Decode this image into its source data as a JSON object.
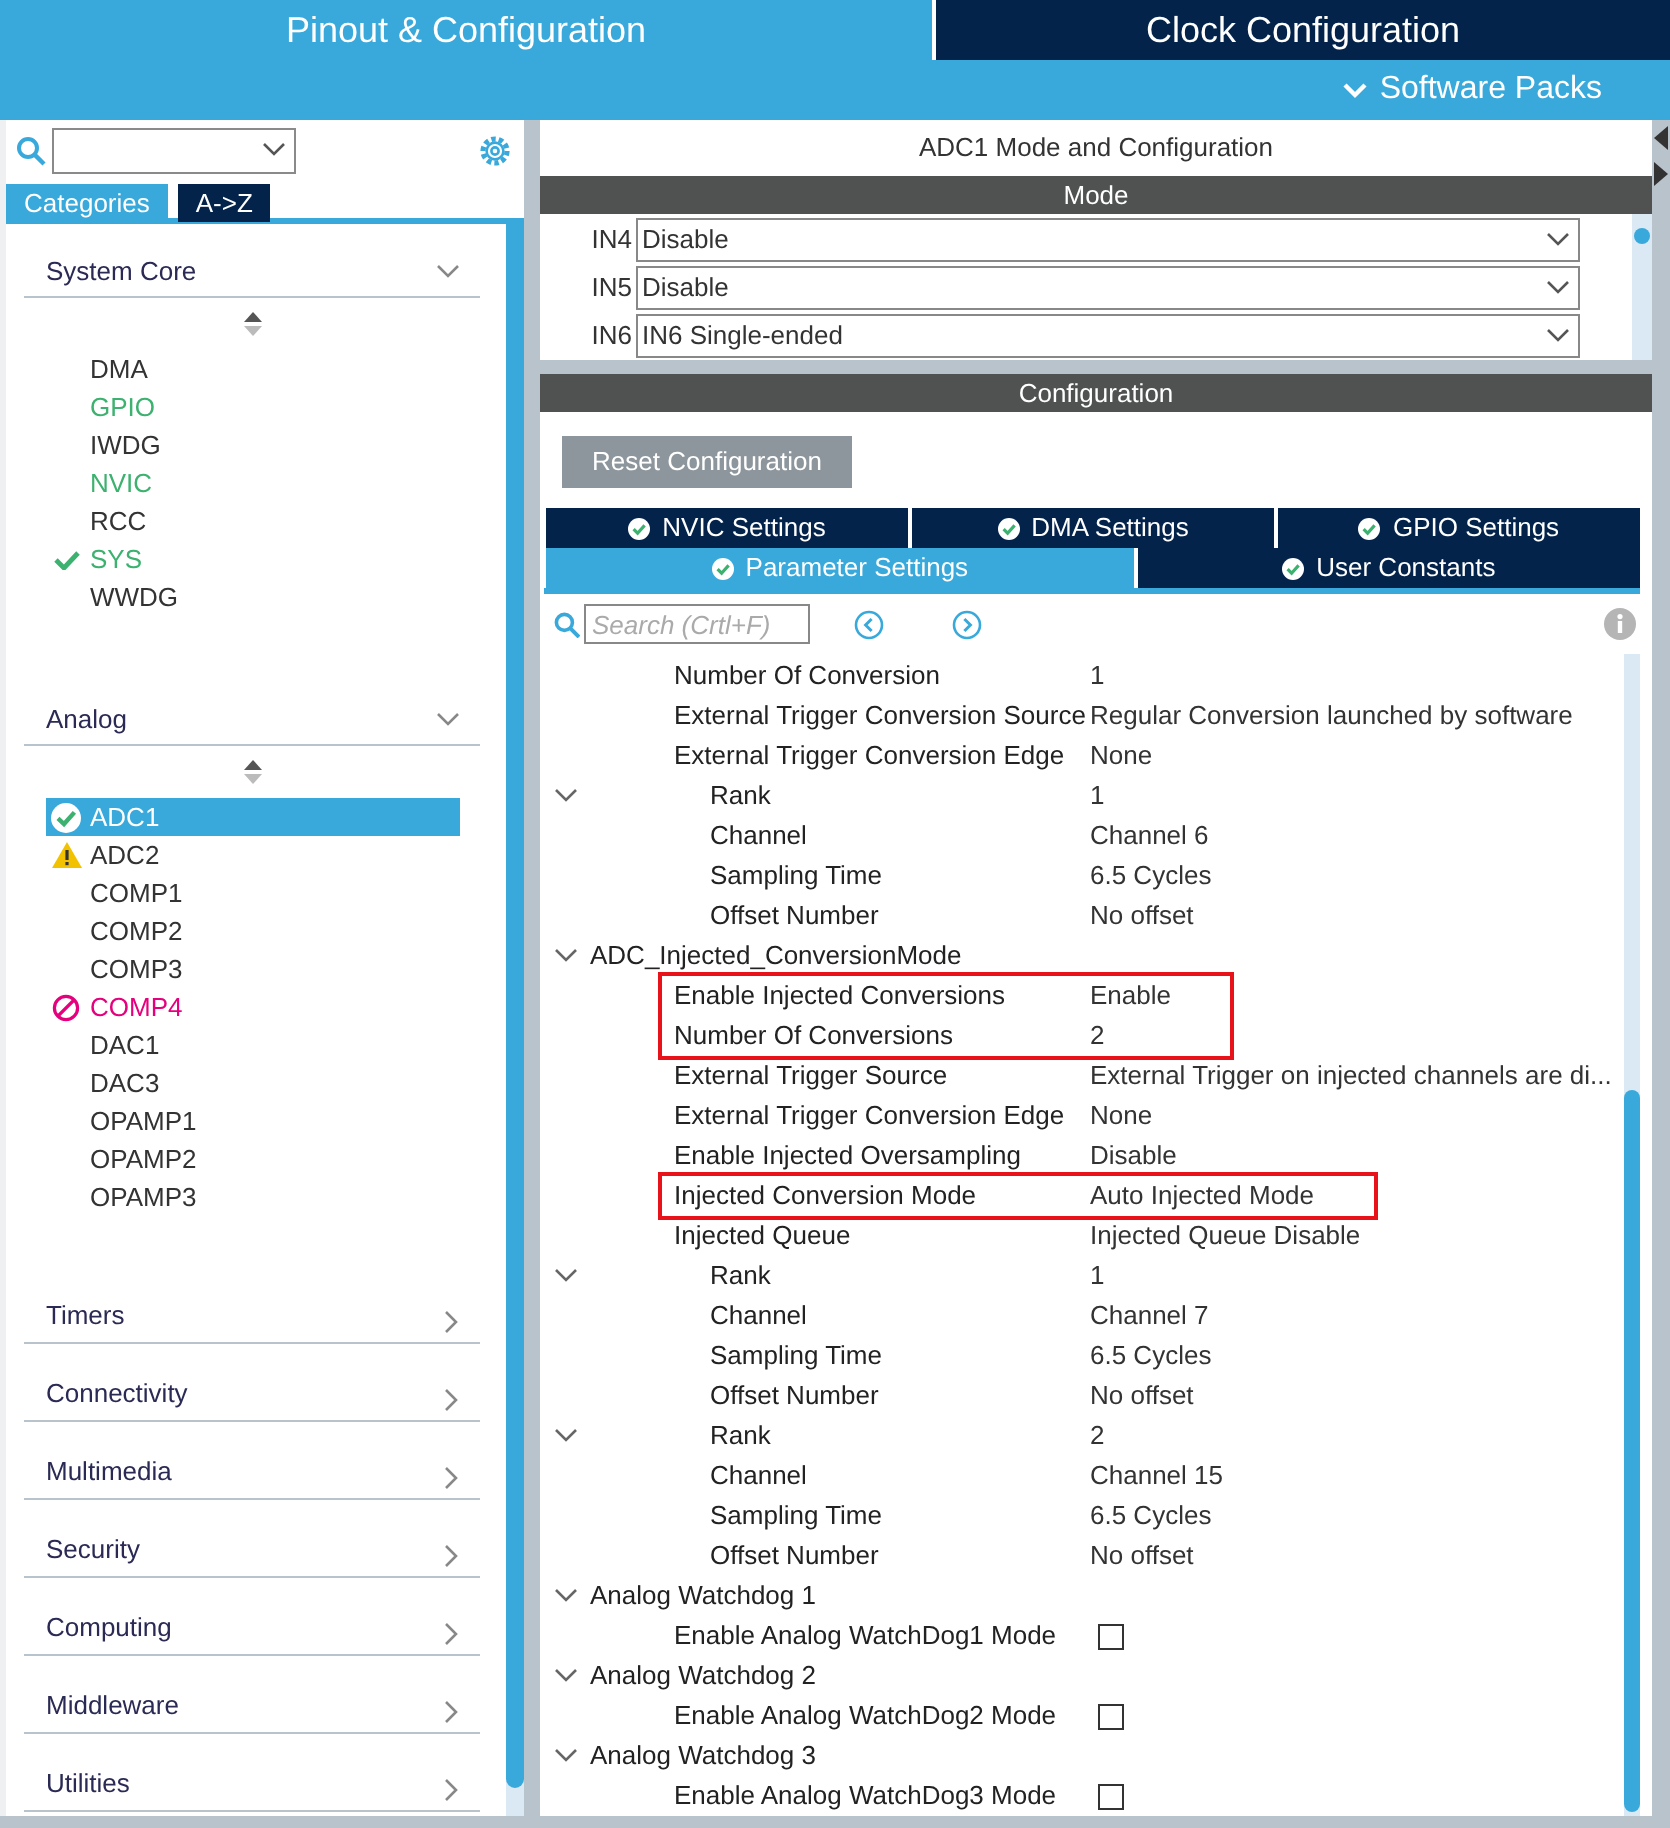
{
  "top_tabs": [
    {
      "label": "Pinout & Configuration",
      "selected": true
    },
    {
      "label": "Clock Configuration",
      "selected": false
    }
  ],
  "software_packs": {
    "label": "Software Packs"
  },
  "sidebar": {
    "tabs": [
      {
        "label": "Categories",
        "selected": true
      },
      {
        "label": "A->Z",
        "selected": false
      }
    ],
    "categories": [
      {
        "label": "System Core",
        "expanded": true,
        "items": [
          {
            "label": "DMA",
            "kind": "plain",
            "selected": false
          },
          {
            "label": "GPIO",
            "kind": "enabled",
            "selected": false
          },
          {
            "label": "IWDG",
            "kind": "plain",
            "selected": false
          },
          {
            "label": "NVIC",
            "kind": "enabled",
            "selected": false
          },
          {
            "label": "RCC",
            "kind": "plain",
            "selected": false
          },
          {
            "label": "SYS",
            "kind": "ok",
            "selected": false
          },
          {
            "label": "WWDG",
            "kind": "plain",
            "selected": false
          }
        ]
      },
      {
        "label": "Analog",
        "expanded": true,
        "items": [
          {
            "label": "ADC1",
            "kind": "ok",
            "selected": true
          },
          {
            "label": "ADC2",
            "kind": "warning",
            "selected": false
          },
          {
            "label": "COMP1",
            "kind": "plain",
            "selected": false
          },
          {
            "label": "COMP2",
            "kind": "plain",
            "selected": false
          },
          {
            "label": "COMP3",
            "kind": "plain",
            "selected": false
          },
          {
            "label": "COMP4",
            "kind": "error",
            "selected": false
          },
          {
            "label": "DAC1",
            "kind": "plain",
            "selected": false
          },
          {
            "label": "DAC3",
            "kind": "plain",
            "selected": false
          },
          {
            "label": "OPAMP1",
            "kind": "plain",
            "selected": false
          },
          {
            "label": "OPAMP2",
            "kind": "plain",
            "selected": false
          },
          {
            "label": "OPAMP3",
            "kind": "plain",
            "selected": false
          }
        ]
      },
      {
        "label": "Timers",
        "expanded": false
      },
      {
        "label": "Connectivity",
        "expanded": false
      },
      {
        "label": "Multimedia",
        "expanded": false
      },
      {
        "label": "Security",
        "expanded": false
      },
      {
        "label": "Computing",
        "expanded": false
      },
      {
        "label": "Middleware",
        "expanded": false
      },
      {
        "label": "Utilities",
        "expanded": false
      }
    ]
  },
  "panel": {
    "title": "ADC1 Mode and Configuration",
    "mode_header": "Mode",
    "mode_rows": [
      {
        "label": "IN4",
        "value": "Disable"
      },
      {
        "label": "IN5",
        "value": "Disable"
      },
      {
        "label": "IN6",
        "value": "IN6 Single-ended"
      }
    ],
    "config_header": "Configuration",
    "reset_button": "Reset Configuration",
    "config_tabs": [
      [
        {
          "label": "NVIC Settings",
          "selected": false
        },
        {
          "label": "DMA Settings",
          "selected": false
        },
        {
          "label": "GPIO Settings",
          "selected": false
        }
      ],
      [
        {
          "label": "Parameter Settings",
          "selected": true
        },
        {
          "label": "User Constants",
          "selected": false
        }
      ]
    ],
    "search": {
      "placeholder": "Search (Crtl+F)"
    },
    "tree": [
      {
        "kind": "param",
        "label": "Number Of Conversion",
        "value": "1",
        "highlighted": false
      },
      {
        "kind": "param",
        "label": "External Trigger Conversion Source",
        "value": "Regular Conversion launched by software",
        "highlighted": false
      },
      {
        "kind": "param",
        "label": "External Trigger Conversion Edge",
        "value": "None",
        "highlighted": false
      },
      {
        "kind": "rank",
        "label": "Rank",
        "value": "1",
        "expanded": true,
        "highlighted": false,
        "children": [
          {
            "kind": "param",
            "label": "Channel",
            "value": "Channel 6",
            "highlighted": false
          },
          {
            "kind": "param",
            "label": "Sampling Time",
            "value": "6.5 Cycles",
            "highlighted": false
          },
          {
            "kind": "param",
            "label": "Offset Number",
            "value": "No offset",
            "highlighted": false
          }
        ]
      },
      {
        "kind": "group",
        "label": "ADC_Injected_ConversionMode",
        "expanded": true,
        "highlighted": false,
        "children": [
          {
            "kind": "param",
            "label": "Enable Injected Conversions",
            "value": "Enable",
            "highlighted": true
          },
          {
            "kind": "param",
            "label": "Number Of Conversions",
            "value": "2",
            "highlighted": true
          },
          {
            "kind": "param",
            "label": "External Trigger Source",
            "value": "External Trigger on injected channels are di...",
            "highlighted": false
          },
          {
            "kind": "param",
            "label": "External Trigger Conversion Edge",
            "value": "None",
            "highlighted": false
          },
          {
            "kind": "param",
            "label": "Enable Injected Oversampling",
            "value": "Disable",
            "highlighted": false
          },
          {
            "kind": "param",
            "label": "Injected Conversion Mode",
            "value": "Auto Injected Mode",
            "highlighted": true
          },
          {
            "kind": "param",
            "label": "Injected Queue",
            "value": "Injected Queue Disable",
            "highlighted": false
          },
          {
            "kind": "rank",
            "label": "Rank",
            "value": "1",
            "expanded": true,
            "highlighted": false,
            "children": [
              {
                "kind": "param",
                "label": "Channel",
                "value": "Channel 7",
                "highlighted": false
              },
              {
                "kind": "param",
                "label": "Sampling Time",
                "value": "6.5 Cycles",
                "highlighted": false
              },
              {
                "kind": "param",
                "label": "Offset Number",
                "value": "No offset",
                "highlighted": false
              }
            ]
          },
          {
            "kind": "rank",
            "label": "Rank",
            "value": "2",
            "expanded": true,
            "highlighted": false,
            "children": [
              {
                "kind": "param",
                "label": "Channel",
                "value": "Channel 15",
                "highlighted": false
              },
              {
                "kind": "param",
                "label": "Sampling Time",
                "value": "6.5 Cycles",
                "highlighted": false
              },
              {
                "kind": "param",
                "label": "Offset Number",
                "value": "No offset",
                "highlighted": false
              }
            ]
          }
        ]
      },
      {
        "kind": "group",
        "label": "Analog Watchdog 1",
        "expanded": true,
        "highlighted": false,
        "children": [
          {
            "kind": "checkbox",
            "label": "Enable Analog WatchDog1 Mode",
            "checked": false,
            "highlighted": false
          }
        ]
      },
      {
        "kind": "group",
        "label": "Analog Watchdog 2",
        "expanded": true,
        "highlighted": false,
        "children": [
          {
            "kind": "checkbox",
            "label": "Enable Analog WatchDog2 Mode",
            "checked": false,
            "highlighted": false
          }
        ]
      },
      {
        "kind": "group",
        "label": "Analog Watchdog 3",
        "expanded": true,
        "highlighted": false,
        "children": [
          {
            "kind": "checkbox",
            "label": "Enable Analog WatchDog3 Mode",
            "checked": false,
            "highlighted": false
          }
        ]
      }
    ]
  }
}
